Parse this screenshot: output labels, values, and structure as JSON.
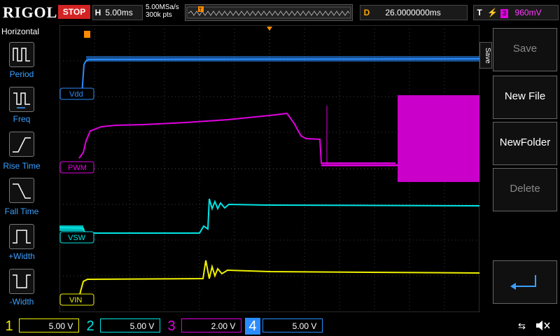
{
  "brand": "RIGOL",
  "run_state": "STOP",
  "horizontal": {
    "label": "H",
    "timebase": "5.00ms"
  },
  "sample_rate": "5.00MSa/s",
  "points": "300k pts",
  "delay": {
    "label": "D",
    "value": "26.0000000ms"
  },
  "trigger": {
    "label": "T",
    "source": "3",
    "level": "960mV"
  },
  "left_panel": {
    "title": "Horizontal",
    "items": [
      {
        "label": "Period",
        "icon": "period-icon"
      },
      {
        "label": "Freq",
        "icon": "freq-icon"
      },
      {
        "label": "Rise Time",
        "icon": "rise-time-icon"
      },
      {
        "label": "Fall Time",
        "icon": "fall-time-icon"
      },
      {
        "label": "+Width",
        "icon": "pos-width-icon"
      },
      {
        "label": "-Width",
        "icon": "neg-width-icon"
      }
    ]
  },
  "right_panel": {
    "tab": "Save",
    "buttons": [
      {
        "label": "Save",
        "enabled": false
      },
      {
        "label": "New File",
        "enabled": true
      },
      {
        "label": "NewFolder",
        "enabled": true
      },
      {
        "label": "Delete",
        "enabled": false
      }
    ]
  },
  "traces": {
    "ch4_label": "Vdd",
    "ch3_label": "PWM",
    "ch2_label": "VSW",
    "ch1_label": "VIN"
  },
  "channels": [
    {
      "num": "1",
      "scale": "5.00 V",
      "color": "#f0f000"
    },
    {
      "num": "2",
      "scale": "5.00 V",
      "color": "#00e5e5"
    },
    {
      "num": "3",
      "scale": "2.00 V",
      "color": "#e000e0"
    },
    {
      "num": "4",
      "scale": "5.00 V",
      "color": "#2a8cff"
    }
  ]
}
